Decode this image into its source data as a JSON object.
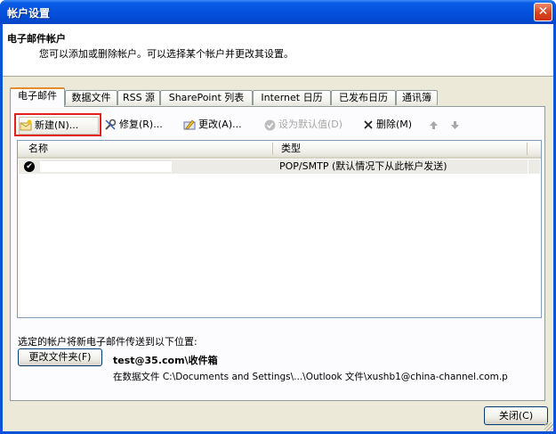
{
  "window": {
    "title": "帐户设置",
    "close_glyph": "✕"
  },
  "header": {
    "title": "电子邮件帐户",
    "subtitle": "您可以添加或删除帐户。可以选择某个帐户并更改其设置。"
  },
  "tabs": [
    {
      "label": "电子邮件",
      "active": true
    },
    {
      "label": "数据文件",
      "active": false
    },
    {
      "label": "RSS 源",
      "active": false
    },
    {
      "label": "SharePoint 列表",
      "active": false
    },
    {
      "label": "Internet 日历",
      "active": false
    },
    {
      "label": "已发布日历",
      "active": false
    },
    {
      "label": "通讯簿",
      "active": false
    }
  ],
  "toolbar": {
    "new": "新建(N)...",
    "repair": "修复(R)...",
    "change": "更改(A)...",
    "set_default": "设为默认值(D)",
    "remove": "删除(M)",
    "move_up_icon": "arrow-up-icon",
    "move_down_icon": "arrow-down-icon"
  },
  "list": {
    "columns": [
      "名称",
      "类型"
    ],
    "rows": [
      {
        "name": "",
        "type": "POP/SMTP (默认情况下从此帐户发送)",
        "default": true
      }
    ]
  },
  "delivery": {
    "label": "选定的帐户将新电子邮件传送到以下位置:",
    "change_folder": "更改文件夹(F)",
    "target": "test@35.com\\收件箱",
    "file": "在数据文件 C:\\Documents and Settings\\...\\Outlook 文件\\xushb1@china-channel.com.p"
  },
  "footer": {
    "close": "关闭(C)"
  },
  "colors": {
    "titlebar": "#0550dc",
    "highlight": "#e02020",
    "tab_accent": "#e68b2c"
  }
}
